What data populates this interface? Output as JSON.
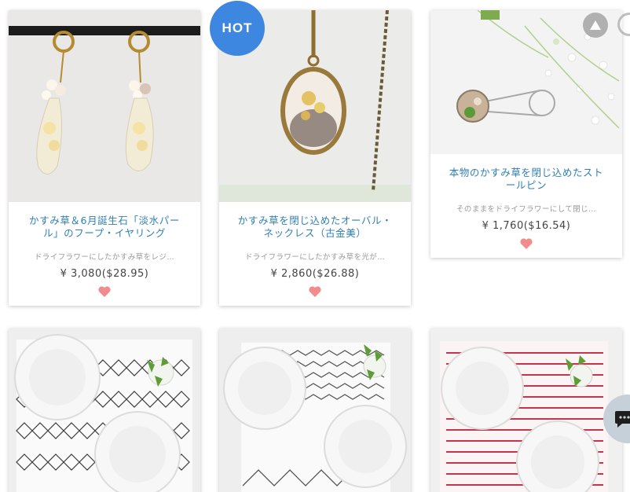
{
  "badge": {
    "label": "HOT"
  },
  "products": [
    {
      "title": "かすみ草＆6月誕生石「淡水パール」のフープ・イヤリング",
      "description": "ドライフラワーにしたかすみ草をレジ…",
      "price": "¥ 3,080($28.95)"
    },
    {
      "title": "かすみ草を閉じ込めたオーバル・ネックレス（古金美）",
      "description": "ドライフラワーにしたかすみ草を光が…",
      "price": "¥ 2,860($26.88)"
    },
    {
      "title": "本物のかすみ草を閉じ込めたストールピン",
      "description": "そのままをドライフラワーにして閉じ…",
      "price": "¥ 1,760($16.54)"
    }
  ],
  "colors": {
    "title": "#2f7fb6",
    "heart": "#f08c8c",
    "badge": "#3d87e0",
    "price": "#444444",
    "description": "#9a9a9a"
  },
  "icons": {
    "heart": "heart-icon",
    "scroll_top": "triangle-up-icon",
    "chat": "chat-bubble-icon"
  }
}
